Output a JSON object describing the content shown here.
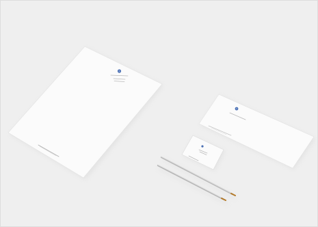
{
  "scene": {
    "description_label": "",
    "objects": [
      {
        "name": "letterhead",
        "shape": "paper-sheet",
        "tone": "white"
      },
      {
        "name": "envelope",
        "shape": "envelope",
        "tone": "white"
      },
      {
        "name": "business-card",
        "shape": "card",
        "tone": "white"
      },
      {
        "name": "pencil",
        "shape": "pencil",
        "tone": "silver"
      },
      {
        "name": "pen",
        "shape": "pen",
        "tone": "silver"
      }
    ],
    "colors": {
      "background": "#efefef",
      "paper": "#fbfbfb",
      "shadow": "#d6d6d6",
      "logo": "#4a6fb3",
      "text_lines": "#b9b9b9",
      "metal": "#b8b8b8",
      "tip": "#b47a2a"
    }
  }
}
